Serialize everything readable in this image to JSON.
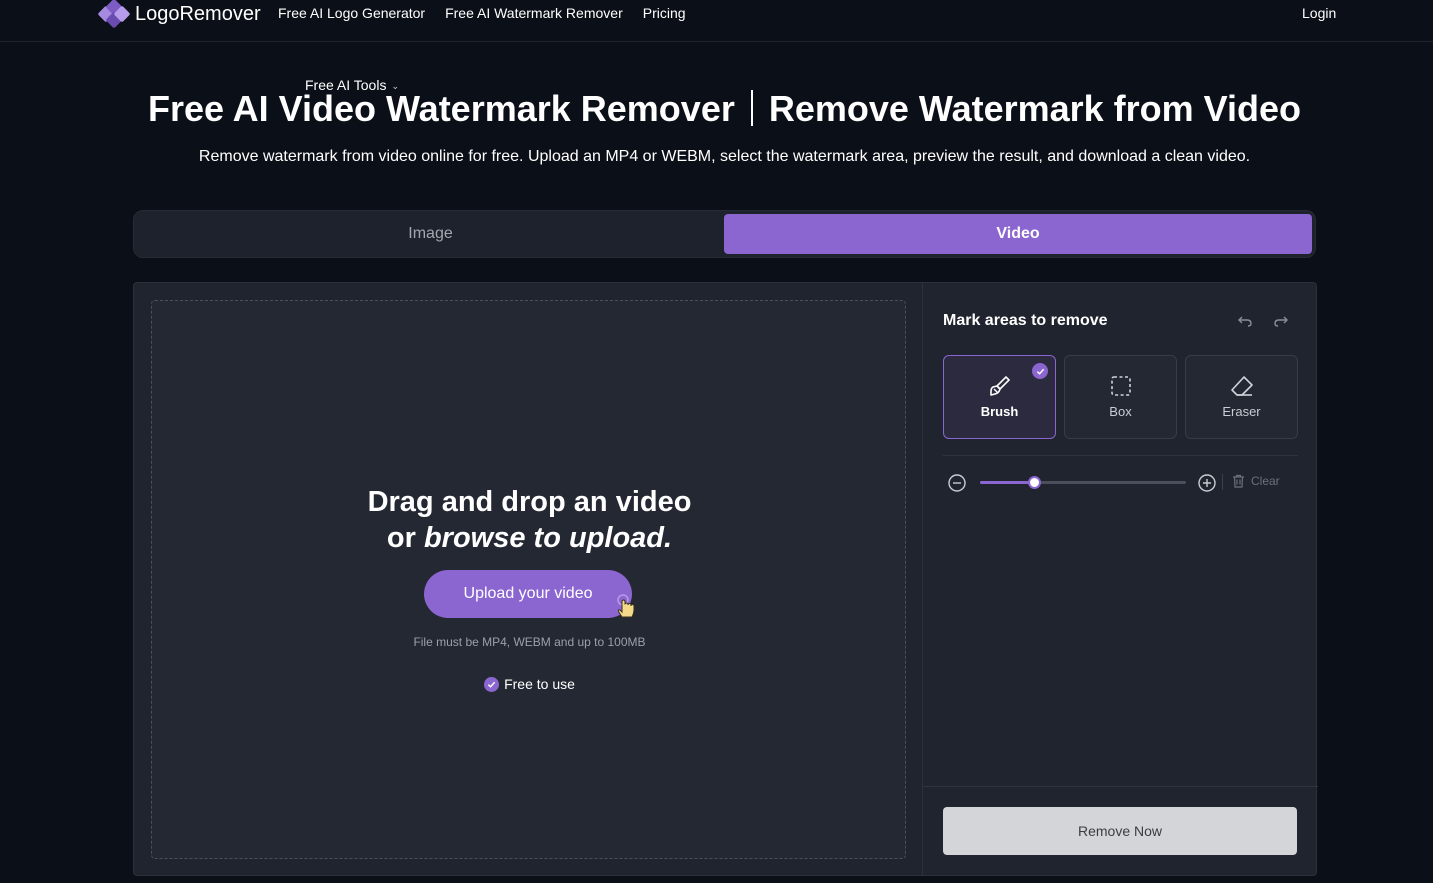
{
  "nav": {
    "brand": "LogoRemover",
    "links": [
      {
        "label": "Free AI Logo Generator"
      },
      {
        "label": "Free AI Watermark Remover"
      },
      {
        "label": "Free AI Tools"
      },
      {
        "label": "Pricing"
      }
    ],
    "login": "Login"
  },
  "hero": {
    "title_left": "Free AI Video Watermark Remover",
    "title_right": "Remove Watermark from Video",
    "subtitle": "Remove watermark from video online for free. Upload an MP4 or WEBM, select the watermark area, preview the result, and download a clean video."
  },
  "tabs": [
    {
      "label": "Image",
      "active": false
    },
    {
      "label": "Video",
      "active": true
    }
  ],
  "upload": {
    "title_line1": "Drag and drop an video",
    "title_line2_prefix": "or ",
    "title_line2_em": "browse to upload.",
    "button": "Upload your video",
    "note": "File must be MP4, WEBM and up to 100MB",
    "free": "Free to use"
  },
  "panel": {
    "title": "Mark areas to remove",
    "tools": [
      {
        "label": "Brush",
        "icon": "brush-icon",
        "selected": true
      },
      {
        "label": "Box",
        "icon": "box-select-icon",
        "selected": false
      },
      {
        "label": "Eraser",
        "icon": "eraser-icon",
        "selected": false
      }
    ],
    "brush_size": 0.26,
    "clear": "Clear",
    "remove_button": "Remove Now"
  },
  "colors": {
    "accent": "#8b66d0",
    "background": "#0b0f17",
    "panel": "#20242e"
  }
}
